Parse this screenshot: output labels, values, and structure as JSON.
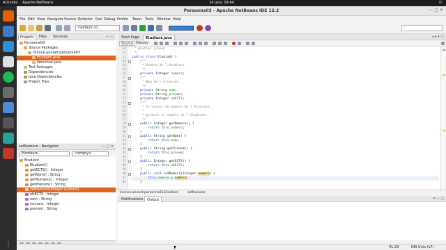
{
  "topbar": {
    "activities": "Activités",
    "app": "Apache NetBeans",
    "clock": "14 janv. 09:44"
  },
  "window": {
    "title": "Personne03 - Apache NetBeans IDE 12.2"
  },
  "menu": [
    "File",
    "Edit",
    "View",
    "Navigate",
    "Source",
    "Refactor",
    "Run",
    "Debug",
    "Profile",
    "Team",
    "Tools",
    "Window",
    "Help"
  ],
  "toolbar": {
    "config": "<default co...",
    "memory": ""
  },
  "projects_panel": {
    "tabs": [
      "Projects",
      "Files",
      "Services"
    ],
    "items": [
      {
        "label": "Personne03"
      },
      {
        "label": "Source Packages"
      },
      {
        "label": "licence.anneet.personne03"
      },
      {
        "label": "Etudiant.java"
      },
      {
        "label": "Personne.java"
      },
      {
        "label": "Test Packages"
      },
      {
        "label": "Dependencies"
      },
      {
        "label": "Java Dependencies"
      },
      {
        "label": "Project Files"
      }
    ]
  },
  "navigator": {
    "title": "setNumero - Navigator",
    "filter": "Members",
    "scope": "<empty>",
    "items": [
      {
        "label": "Etudiant"
      },
      {
        "label": "Etudiant()"
      },
      {
        "label": "getECTS() : Integer"
      },
      {
        "label": "getNom() : String"
      },
      {
        "label": "getNumero() : Integer"
      },
      {
        "label": "getPrenom() : String"
      },
      {
        "label": "setNumero(Integer numero)"
      },
      {
        "label": "nbECTS : Integer"
      },
      {
        "label": "nom : String"
      },
      {
        "label": "numero : Integer"
      },
      {
        "label": "prenom : String"
      }
    ]
  },
  "editor": {
    "tabs": [
      "Start Page",
      "Etudiant.java"
    ],
    "views": [
      "Source",
      "History"
    ],
    "lines": [
      {
        "n": "10",
        "text": " * @author jcloud"
      },
      {
        "n": "11",
        "text": " */"
      },
      {
        "n": "12",
        "text": "public class Etudiant {"
      },
      {
        "n": "13",
        "text": "    /**"
      },
      {
        "n": "14",
        "text": "     * Numéro de l'étudiant."
      },
      {
        "n": "15",
        "text": "     */"
      },
      {
        "n": "16",
        "text": "    private Integer numero;"
      },
      {
        "n": "17",
        "text": "    /**"
      },
      {
        "n": "18",
        "text": "     * Nom de l'étudiant."
      },
      {
        "n": "19",
        "text": "     */"
      },
      {
        "n": "20",
        "text": "    private String nom;"
      },
      {
        "n": "21",
        "text": "    private String prenom;"
      },
      {
        "n": "22",
        "text": "    private Integer nbECTS;"
      },
      {
        "n": "23",
        "text": "    /**"
      },
      {
        "n": "24",
        "text": "     * Accesseur du numéro de l'étudiant."
      },
      {
        "n": "25",
        "text": "     *"
      },
      {
        "n": "26",
        "text": "     * @return le numéro de l'étudiant."
      },
      {
        "n": "27",
        "text": "     */"
      },
      {
        "n": "28",
        "text": "    public Integer getNumero() {"
      },
      {
        "n": "29",
        "text": "        return this.numero;"
      },
      {
        "n": "30",
        "text": "    }"
      },
      {
        "n": "31",
        "text": "    public String getNom() {"
      },
      {
        "n": "32",
        "text": "        return this.nom;"
      },
      {
        "n": "33",
        "text": "    }"
      },
      {
        "n": "34",
        "text": "    public String getPrenom() {"
      },
      {
        "n": "35",
        "text": "        return this.prenom;"
      },
      {
        "n": "36",
        "text": "    }"
      },
      {
        "n": "37",
        "text": "    public Integer getECTS() {"
      },
      {
        "n": "38",
        "text": "        return this.nbECTS;"
      },
      {
        "n": "39",
        "text": "    }"
      },
      {
        "n": "40",
        "text": "    public void setNumero(Integer numero) {"
      },
      {
        "n": "41",
        "text": "        this.numero = numero;"
      },
      {
        "n": "42",
        "text": "    }"
      }
    ]
  },
  "breadcrumb": [
    "licence.anneet.personne03.Etudiant",
    "setNumero"
  ],
  "output": {
    "tabs": [
      "Notifications",
      "Output"
    ]
  },
  "status": {
    "position": "41:29",
    "mode": "INS Unix (LF)"
  }
}
